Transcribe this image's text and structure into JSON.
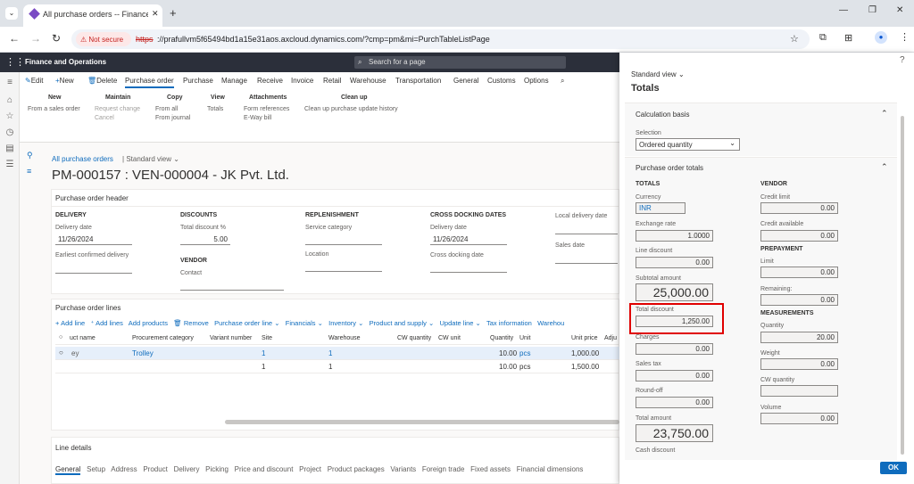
{
  "browser": {
    "tab_title": "All purchase orders -- Finance a",
    "new_tab": "+",
    "not_secure": "Not secure",
    "url_scheme": "https",
    "url_rest": "://prafullvm5f65494bd1a15e31aos.axcloud.dynamics.com/?cmp=pm&mi=PurchTableListPage"
  },
  "app": {
    "name": "Finance and Operations",
    "search_placeholder": "Search for a page"
  },
  "ribbon": {
    "actions": [
      "Edit",
      "New",
      "Delete"
    ],
    "tabs": [
      "Purchase order",
      "Purchase",
      "Manage",
      "Receive",
      "Invoice",
      "Retail",
      "Warehouse",
      "Transportation",
      "General",
      "Customs",
      "Options"
    ],
    "groups": [
      {
        "title": "New",
        "items": [
          "From a sales order"
        ]
      },
      {
        "title": "Maintain",
        "items": [
          "Request change",
          "Cancel"
        ]
      },
      {
        "title": "Copy",
        "items": [
          "From all",
          "From journal"
        ]
      },
      {
        "title": "View",
        "items": [
          "Totals"
        ]
      },
      {
        "title": "Attachments",
        "items": [
          "Form references",
          "E-Way bill"
        ]
      },
      {
        "title": "Clean up",
        "items": [
          "Clean up purchase update history"
        ]
      }
    ]
  },
  "page": {
    "breadcrumb": "All purchase orders",
    "view": "Standard view",
    "title": "PM-000157 : VEN-000004 - JK Pvt. Ltd."
  },
  "header_section": {
    "title": "Purchase order header",
    "delivery": {
      "heading": "DELIVERY",
      "delivery_date_label": "Delivery date",
      "delivery_date": "11/26/2024",
      "earliest_label": "Earliest confirmed delivery"
    },
    "discounts": {
      "heading": "DISCOUNTS",
      "total_discount_label": "Total discount %",
      "total_discount": "5.00"
    },
    "vendor": {
      "heading": "VENDOR",
      "contact_label": "Contact"
    },
    "replenishment": {
      "heading": "REPLENISHMENT",
      "service_category_label": "Service category",
      "location_label": "Location"
    },
    "cross_docking": {
      "heading": "CROSS DOCKING DATES",
      "delivery_date_label": "Delivery date",
      "delivery_date": "11/26/2024",
      "cross_docking_label": "Cross docking date"
    },
    "local": {
      "local_delivery_label": "Local delivery date",
      "sales_date_label": "Sales date"
    }
  },
  "lines": {
    "title": "Purchase order lines",
    "toolbar": [
      "Add line",
      "Add lines",
      "Add products",
      "Remove",
      "Purchase order line",
      "Financials",
      "Inventory",
      "Product and supply",
      "Update line",
      "Tax information",
      "Warehou"
    ],
    "columns": [
      "uct name",
      "Procurement category",
      "Variant number",
      "Site",
      "Warehouse",
      "CW quantity",
      "CW unit",
      "Quantity",
      "Unit",
      "Unit price",
      "Adju"
    ],
    "rows": [
      {
        "name": "ey",
        "category": "Trolley",
        "variant": "",
        "site": "1",
        "warehouse": "1",
        "cwq": "",
        "cwu": "",
        "qty": "10.00",
        "unit": "pcs",
        "price": "1,000.00"
      },
      {
        "name": "",
        "category": "",
        "variant": "",
        "site": "1",
        "warehouse": "1",
        "cwq": "",
        "cwu": "",
        "qty": "10.00",
        "unit": "pcs",
        "price": "1,500.00"
      }
    ]
  },
  "line_details": {
    "title": "Line details",
    "tabs": [
      "General",
      "Setup",
      "Address",
      "Product",
      "Delivery",
      "Picking",
      "Price and discount",
      "Project",
      "Product packages",
      "Variants",
      "Foreign trade",
      "Fixed assets",
      "Financial dimensions"
    ]
  },
  "totals": {
    "view": "Standard view",
    "title": "Totals",
    "calc_basis": "Calculation basis",
    "selection_label": "Selection",
    "selection_value": "Ordered quantity",
    "po_totals": "Purchase order totals",
    "totals_heading": "TOTALS",
    "currency_label": "Currency",
    "currency": "INR",
    "exchange_rate_label": "Exchange rate",
    "exchange_rate": "1.0000",
    "line_discount_label": "Line discount",
    "line_discount": "0.00",
    "subtotal_label": "Subtotal amount",
    "subtotal": "25,000.00",
    "total_discount_label": "Total discount",
    "total_discount": "1,250.00",
    "charges_label": "Charges",
    "charges": "0.00",
    "sales_tax_label": "Sales tax",
    "sales_tax": "0.00",
    "round_off_label": "Round-off",
    "round_off": "0.00",
    "total_amount_label": "Total amount",
    "total_amount": "23,750.00",
    "cash_discount_label": "Cash discount",
    "vendor_heading": "VENDOR",
    "credit_limit_label": "Credit limit",
    "credit_limit": "0.00",
    "credit_available_label": "Credit available",
    "credit_available": "0.00",
    "prepayment_heading": "PREPAYMENT",
    "limit_label": "Limit",
    "limit": "0.00",
    "remaining_label": "Remaining:",
    "remaining": "0.00",
    "measurements_heading": "MEASUREMENTS",
    "quantity_label": "Quantity",
    "quantity": "20.00",
    "weight_label": "Weight",
    "weight": "0.00",
    "cw_quantity_label": "CW quantity",
    "cw_quantity": "",
    "volume_label": "Volume",
    "volume": "0.00",
    "ok": "OK"
  },
  "colors": {
    "accent": "#0f6cbd",
    "highlight": "#e00000",
    "appbar": "#2b2f3a"
  }
}
